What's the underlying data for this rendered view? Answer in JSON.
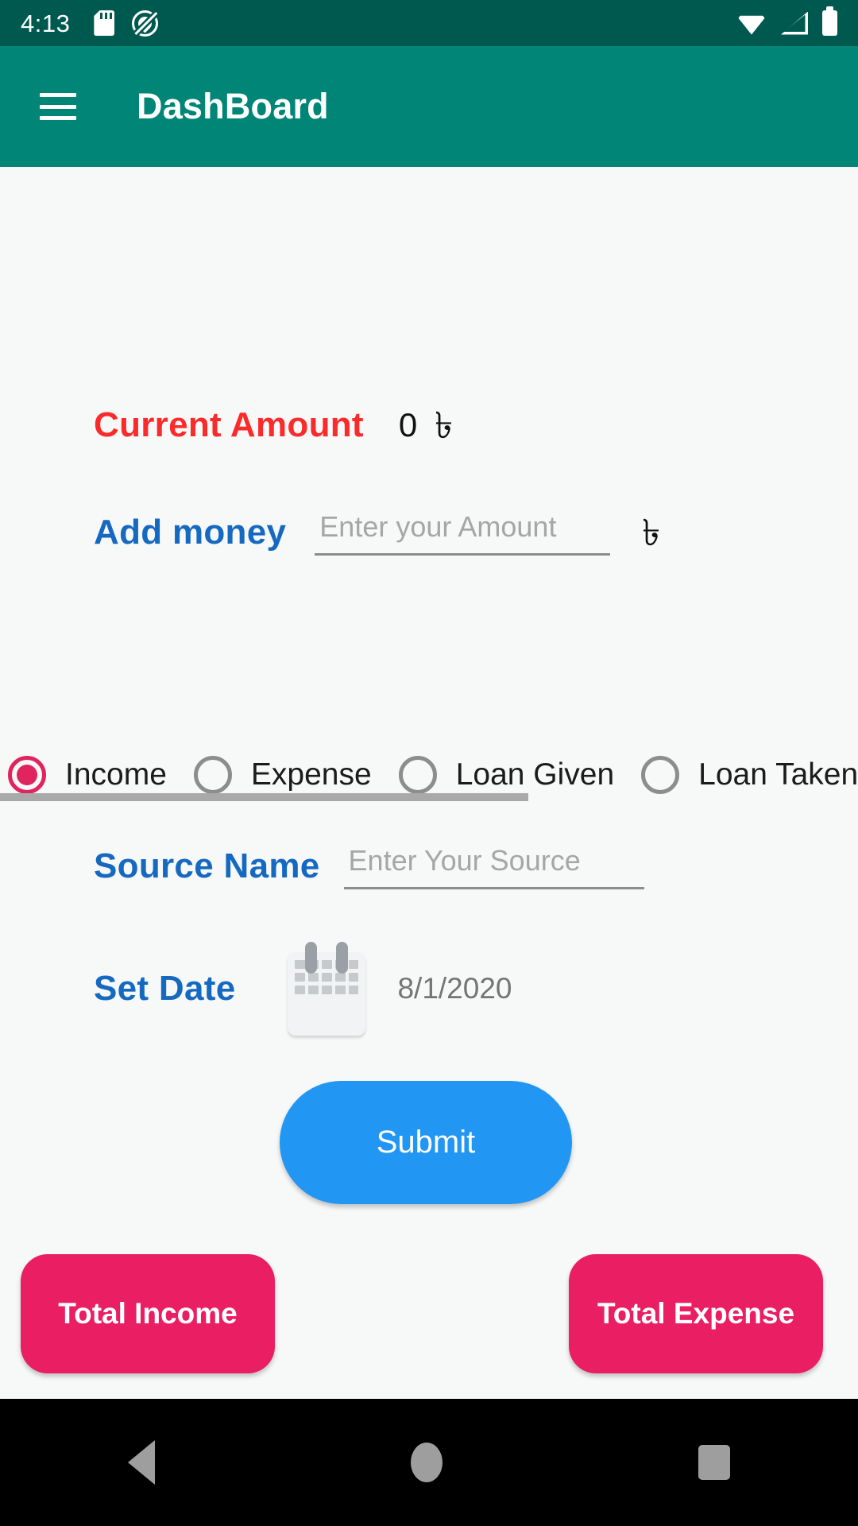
{
  "status_bar": {
    "time": "4:13",
    "icons": [
      "sd-card-icon",
      "android-q-icon",
      "wifi-icon",
      "cellular-signal-icon",
      "battery-icon"
    ]
  },
  "app_bar": {
    "menu_icon": "hamburger-menu-icon",
    "title": "DashBoard"
  },
  "form": {
    "current_amount": {
      "label": "Current Amount",
      "value": "0",
      "currency": "৳"
    },
    "add_money": {
      "label": "Add money",
      "input_value": "",
      "placeholder": "Enter your Amount",
      "currency": "৳"
    },
    "transaction_types": [
      {
        "label": "Income",
        "selected": true
      },
      {
        "label": "Expense",
        "selected": false
      },
      {
        "label": "Loan Given",
        "selected": false
      },
      {
        "label": "Loan Taken",
        "selected": false
      }
    ],
    "source_name": {
      "label": "Source Name",
      "input_value": "",
      "placeholder": "Enter Your Source"
    },
    "set_date": {
      "label": "Set Date",
      "icon": "calendar-icon",
      "value": "8/1/2020"
    },
    "submit_label": "Submit"
  },
  "summary": {
    "total_income_label": "Total Income",
    "total_expense_label": "Total Expense"
  },
  "nav_bar": {
    "back": "back-icon",
    "home": "home-icon",
    "recents": "recents-icon"
  },
  "colors": {
    "status_bar": "#00594f",
    "app_bar": "#008577",
    "accent_red": "#fb2b2b",
    "accent_blue": "#1569c0",
    "submit_blue": "#2196f3",
    "pink": "#e91e63",
    "radio_selected": "#e0245e",
    "background": "#f7f8f8"
  }
}
